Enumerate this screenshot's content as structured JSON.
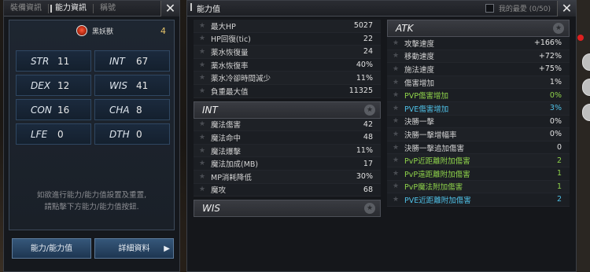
{
  "left_panel": {
    "tabs": [
      "裝備資訊",
      "能力資訊",
      "稱號"
    ],
    "active_tab": 1,
    "class_name": "黑妖獸",
    "level": "4",
    "stats": [
      {
        "name": "STR",
        "value": "11"
      },
      {
        "name": "INT",
        "value": "67"
      },
      {
        "name": "DEX",
        "value": "12"
      },
      {
        "name": "WIS",
        "value": "41"
      },
      {
        "name": "CON",
        "value": "16"
      },
      {
        "name": "CHA",
        "value": "8"
      },
      {
        "name": "LFE",
        "value": "0"
      },
      {
        "name": "DTH",
        "value": "0"
      }
    ],
    "hint_line1": "如欲進行能力/能力值設置及重置,",
    "hint_line2": "請點擊下方能力/能力值按鈕.",
    "btn_ability": "能力/能力值",
    "btn_detail": "詳細資料",
    "close": "✕"
  },
  "right_panel": {
    "title": "能力值",
    "favorites": "我的最愛 (0/50)",
    "close": "✕",
    "top_rows": [
      {
        "label": "最大HP",
        "value": "5027"
      },
      {
        "label": "HP回復(tic)",
        "value": "22"
      },
      {
        "label": "薬水恢復量",
        "value": "24"
      },
      {
        "label": "薬水恢復率",
        "value": "40%"
      },
      {
        "label": "薬水冷卻時間減少",
        "value": "11%"
      },
      {
        "label": "負重最大值",
        "value": "11325"
      }
    ],
    "int_section": {
      "title": "INT",
      "rows": [
        {
          "label": "魔法傷害",
          "value": "42"
        },
        {
          "label": "魔法命中",
          "value": "48"
        },
        {
          "label": "魔法爆擊",
          "value": "11%"
        },
        {
          "label": "魔法加成(MB)",
          "value": "17"
        },
        {
          "label": "MP消耗降低",
          "value": "30%"
        },
        {
          "label": "魔攻",
          "value": "68"
        }
      ]
    },
    "wis_section": {
      "title": "WIS"
    },
    "atk_section": {
      "title": "ATK",
      "rows": [
        {
          "label": "攻擊速度",
          "value": "+166%",
          "color": "default"
        },
        {
          "label": "移動速度",
          "value": "+72%",
          "color": "default"
        },
        {
          "label": "施法速度",
          "value": "+75%",
          "color": "default"
        },
        {
          "label": "傷害增加",
          "value": "1%",
          "color": "default"
        },
        {
          "label": "PVP傷害增加",
          "value": "0%",
          "color": "green"
        },
        {
          "label": "PVE傷害增加",
          "value": "3%",
          "color": "cyan"
        },
        {
          "label": "決勝一擊",
          "value": "0%",
          "color": "default"
        },
        {
          "label": "決勝一擊增幅率",
          "value": "0%",
          "color": "default"
        },
        {
          "label": "決勝一擊追加傷害",
          "value": "0",
          "color": "default"
        },
        {
          "label": "PvP近距離附加傷害",
          "value": "2",
          "color": "green"
        },
        {
          "label": "PvP遠距離附加傷害",
          "value": "1",
          "color": "green"
        },
        {
          "label": "PvP魔法附加傷害",
          "value": "1",
          "color": "green"
        },
        {
          "label": "PVE近距離附加傷害",
          "value": "2",
          "color": "cyan"
        }
      ]
    }
  }
}
